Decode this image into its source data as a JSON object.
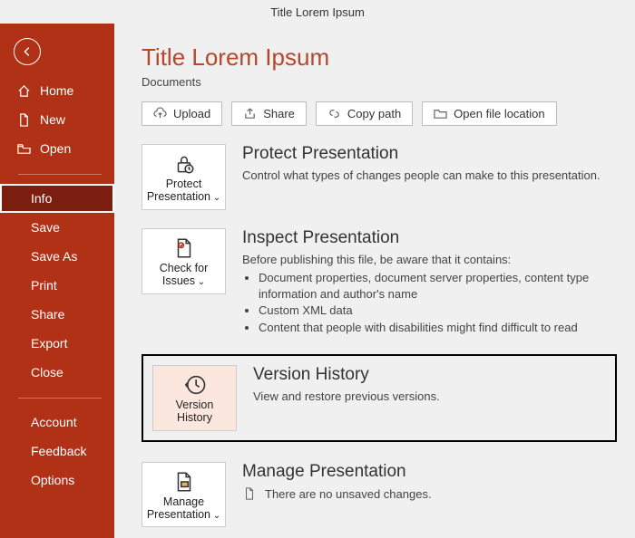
{
  "app_title": "Title Lorem Ipsum",
  "page_title": "Title Lorem Ipsum",
  "page_subtitle": "Documents",
  "sidebar": {
    "home": "Home",
    "new": "New",
    "open": "Open",
    "info": "Info",
    "save": "Save",
    "save_as": "Save As",
    "print": "Print",
    "share": "Share",
    "export": "Export",
    "close": "Close",
    "account": "Account",
    "feedback": "Feedback",
    "options": "Options"
  },
  "toolbar": {
    "upload": "Upload",
    "share": "Share",
    "copy_path": "Copy path",
    "open_loc": "Open file location"
  },
  "cards": {
    "protect": {
      "label": "Protect Presentation"
    },
    "inspect": {
      "label": "Check for Issues"
    },
    "version": {
      "label": "Version History"
    },
    "manage": {
      "label": "Manage Presentation"
    }
  },
  "sections": {
    "protect": {
      "title": "Protect Presentation",
      "desc": "Control what types of changes people can make to this presentation."
    },
    "inspect": {
      "title": "Inspect Presentation",
      "desc": "Before publishing this file, be aware that it contains:",
      "items": [
        "Document properties, document server properties, content type information and author's name",
        "Custom XML data",
        "Content that people with disabilities might find difficult to read"
      ]
    },
    "version": {
      "title": "Version History",
      "desc": "View and restore previous versions."
    },
    "manage": {
      "title": "Manage Presentation",
      "desc": "There are no unsaved changes."
    }
  }
}
